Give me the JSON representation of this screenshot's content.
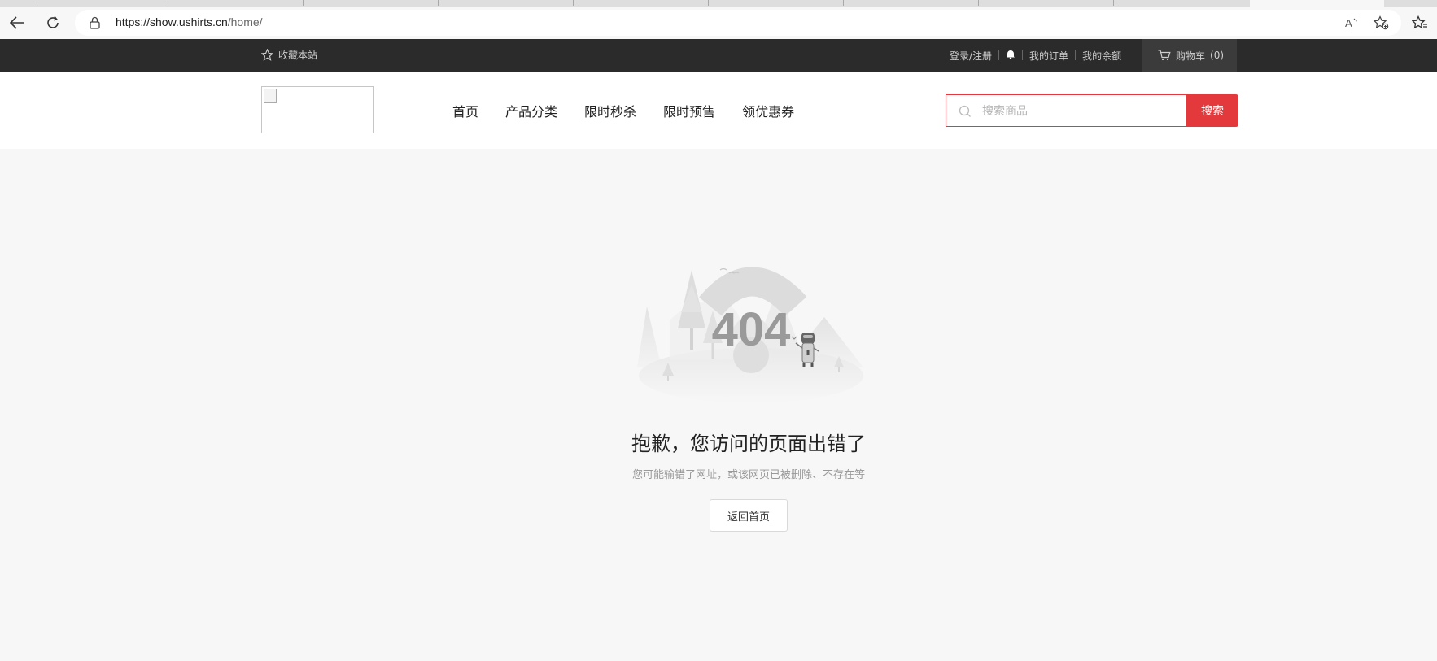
{
  "browser": {
    "url_host": "https://show.ushirts.cn",
    "url_path": "/home/",
    "icons": [
      "back-arrow-icon",
      "refresh-icon",
      "lock-icon",
      "read-aloud-icon",
      "add-favorite-icon",
      "favorites-icon"
    ]
  },
  "topbar": {
    "favorite_label": "收藏本站",
    "login_label": "登录/注册",
    "orders_label": "我的订单",
    "balance_label": "我的余额",
    "cart_label": "购物车",
    "cart_count": "(0)"
  },
  "header": {
    "nav": [
      "首页",
      "产品分类",
      "限时秒杀",
      "限时预售",
      "领优惠券"
    ],
    "search_placeholder": "搜索商品",
    "search_button": "搜索"
  },
  "error": {
    "code": "404",
    "title": "抱歉，您访问的页面出错了",
    "subtitle": "您可能输错了网址，或该网页已被删除、不存在等",
    "back_button": "返回首页"
  },
  "colors": {
    "accent": "#e4393c",
    "topbar_bg": "#2b2b2b",
    "page_bg": "#f7f7f7"
  }
}
